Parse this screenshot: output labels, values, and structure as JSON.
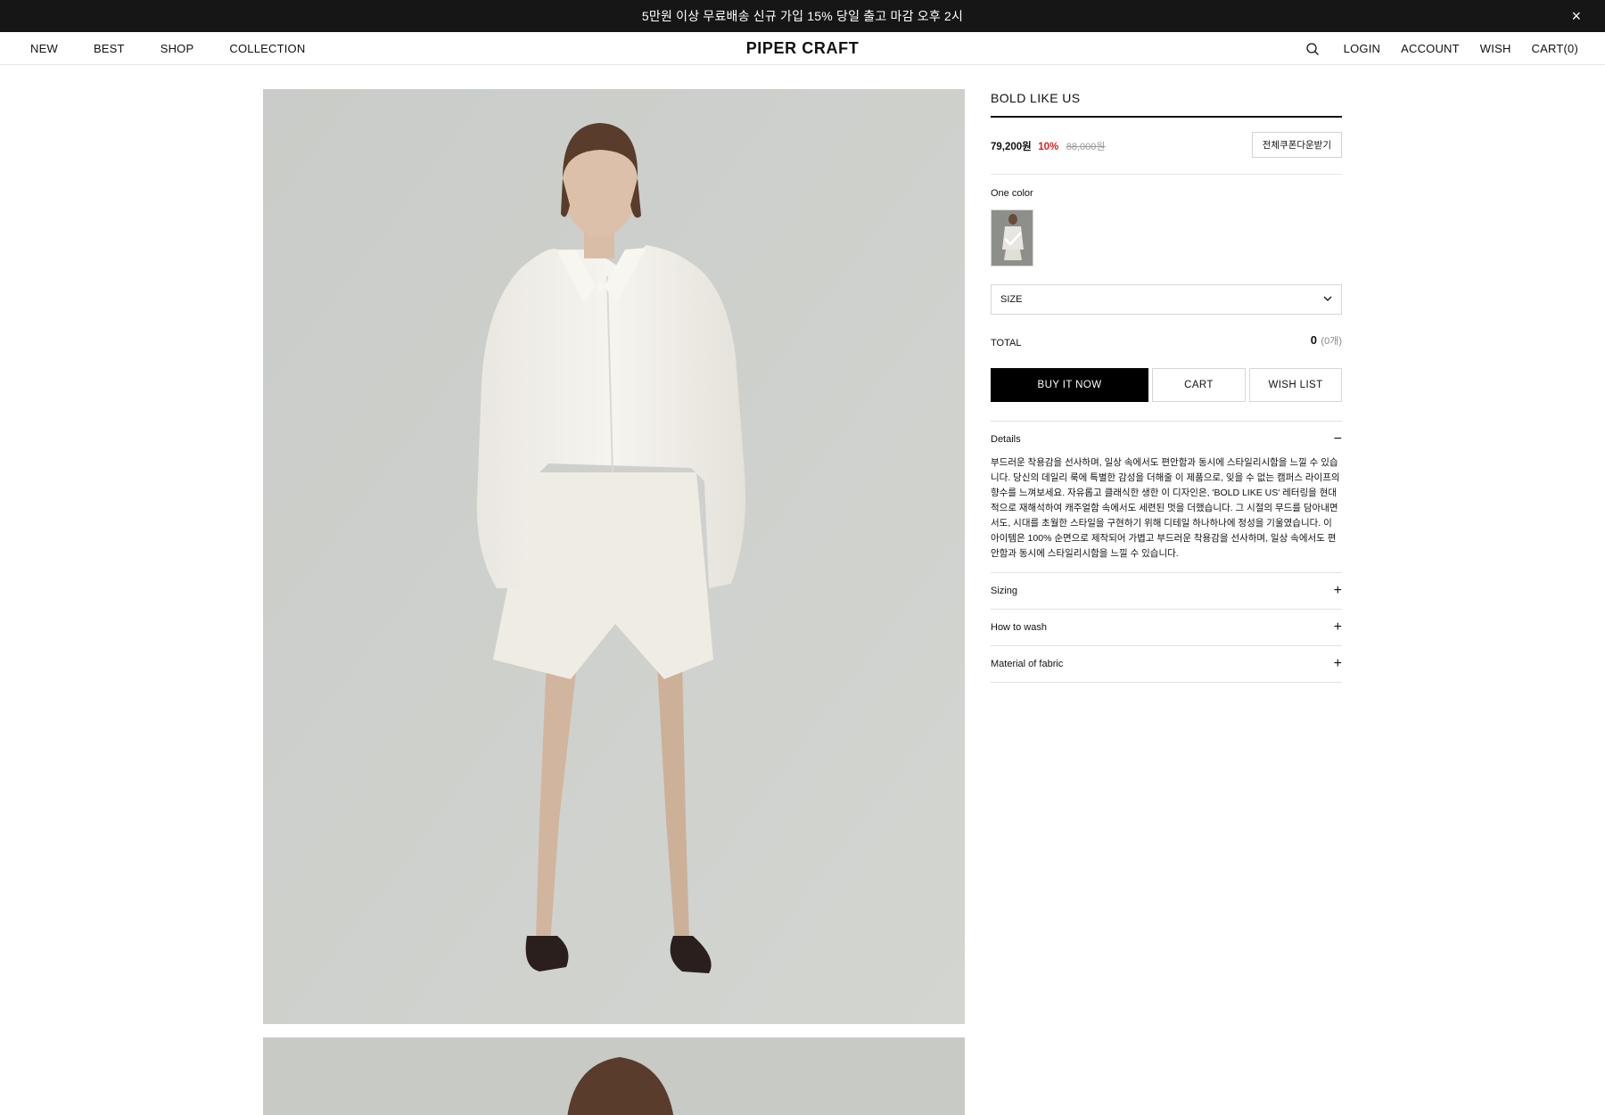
{
  "announcement": {
    "text": "5만원 이상 무료배송 신규 가입 15% 당일 출고 마감 오후 2시",
    "close": "×"
  },
  "header": {
    "logo": "PIPER CRAFT",
    "left_nav": [
      "NEW",
      "BEST",
      "SHOP",
      "COLLECTION"
    ],
    "right_nav": [
      "LOGIN",
      "ACCOUNT",
      "WISH",
      "CART(0)"
    ]
  },
  "product": {
    "title": "BOLD LIKE US",
    "price": "79,200원",
    "discount": "10%",
    "original_price": "88,000원",
    "coupon_label": "전체쿠폰다운받기",
    "color_label": "One color",
    "size_placeholder": "SIZE",
    "total_label": "TOTAL",
    "total_value": "0",
    "total_count": "(0개)",
    "buttons": {
      "buy": "BUY IT NOW",
      "cart": "CART",
      "wish": "WISH LIST"
    }
  },
  "accordion": [
    {
      "title": "Details",
      "sign": "−",
      "open": true,
      "body": "부드러운 착용감을 선사하며, 일상 속에서도 편안함과 동시에 스타일리시함을 느낄 수 있습니다. 당신의 데일리 룩에 특별한 감성을 더해줄 이 제품으로, 잊을 수 없는 캠퍼스 라이프의 향수를 느껴보세요. 자유롭고 클래식한 생한 이 디자인은, 'BOLD LIKE US' 레터링을 현대적으로 재해석하여 캐주얼함 속에서도 세련된 멋을 더했습니다. 그 시절의 무드를 담아내면서도, 시대를 초월한 스타일을 구현하기 위해 디테일 하나하나에 정성을 기울였습니다. 이 아이템은 100% 순면으로 제작되어 가볍고 부드러운 착용감을 선사하며, 일상 속에서도 편안함과 동시에 스타일리시함을 느낄 수 있습니다."
    },
    {
      "title": "Sizing",
      "sign": "+",
      "open": false
    },
    {
      "title": "How to wash",
      "sign": "+",
      "open": false
    },
    {
      "title": "Material of fabric",
      "sign": "+",
      "open": false
    }
  ],
  "colors": {
    "accent_sale": "#e02020",
    "topbar_bg": "#161616",
    "buy_bg": "#000000"
  },
  "icons": {
    "search": "search-icon",
    "chevron": "chevron-down-icon",
    "check": "check-icon",
    "close": "close-icon"
  }
}
